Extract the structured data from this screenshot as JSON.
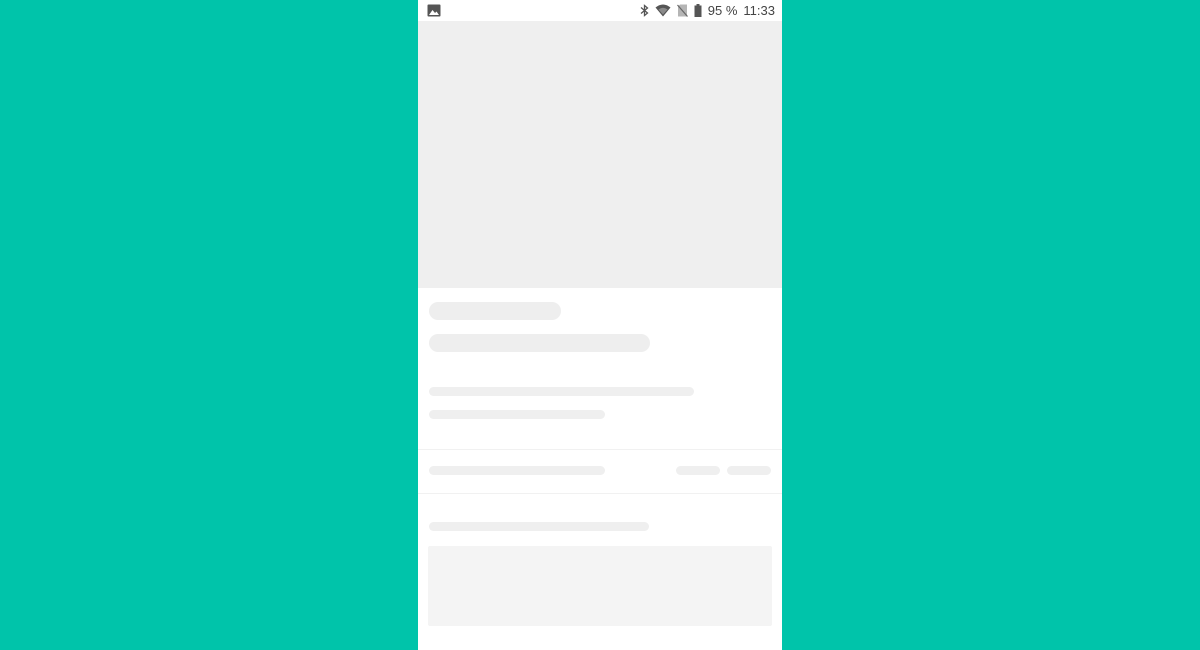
{
  "status_bar": {
    "battery_percent": "95 %",
    "time": "11:33",
    "icons": [
      "gallery-icon",
      "bluetooth-icon",
      "wifi-icon",
      "no-sim-icon",
      "battery-icon"
    ]
  },
  "colors": {
    "background": "#00c4aa",
    "screen": "#ffffff",
    "skeleton": "#eeeeee",
    "skeleton_block": "#f4f4f4"
  },
  "content": {
    "state": "loading-skeleton"
  }
}
